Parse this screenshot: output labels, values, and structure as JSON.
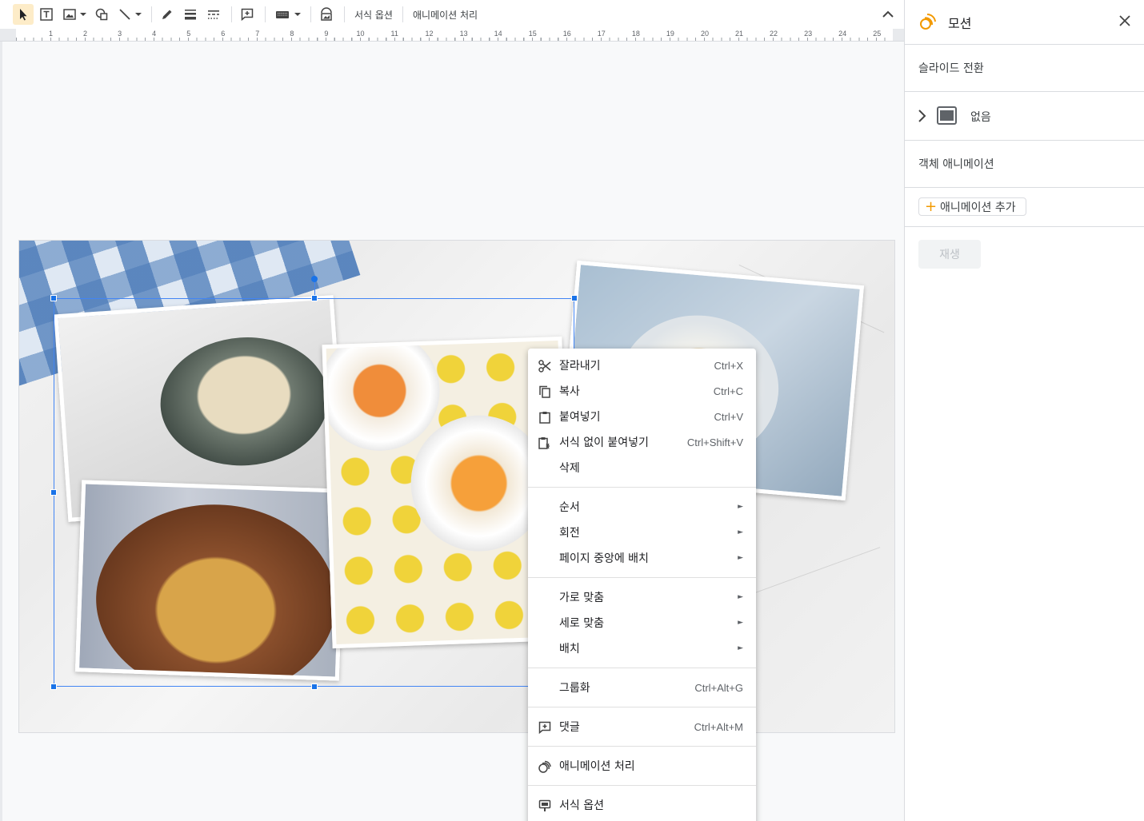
{
  "toolbar": {
    "format_options_label": "서식 옵션",
    "animate_label": "애니메이션 처리"
  },
  "ruler": {
    "numbers": [
      "1",
      "2",
      "3",
      "4",
      "5",
      "6",
      "7",
      "8",
      "9",
      "10",
      "11",
      "12",
      "13",
      "14",
      "15",
      "16",
      "17",
      "18",
      "19",
      "20",
      "21",
      "22",
      "23",
      "24",
      "25"
    ]
  },
  "context_menu": {
    "cut": {
      "label": "잘라내기",
      "shortcut": "Ctrl+X"
    },
    "copy": {
      "label": "복사",
      "shortcut": "Ctrl+C"
    },
    "paste": {
      "label": "붙여넣기",
      "shortcut": "Ctrl+V"
    },
    "paste_plain": {
      "label": "서식 없이 붙여넣기",
      "shortcut": "Ctrl+Shift+V"
    },
    "delete": {
      "label": "삭제"
    },
    "order": {
      "label": "순서"
    },
    "rotate": {
      "label": "회전"
    },
    "center": {
      "label": "페이지 중앙에 배치"
    },
    "align_h": {
      "label": "가로 맞춤"
    },
    "align_v": {
      "label": "세로 맞춤"
    },
    "distribute": {
      "label": "배치"
    },
    "group": {
      "label": "그룹화",
      "shortcut": "Ctrl+Alt+G"
    },
    "comment": {
      "label": "댓글",
      "shortcut": "Ctrl+Alt+M"
    },
    "animate": {
      "label": "애니메이션 처리"
    },
    "format_options": {
      "label": "서식 옵션"
    },
    "submenu_arrow": "►"
  },
  "sidebar": {
    "title": "모션",
    "slide_transition_label": "슬라이드 전환",
    "transition_value": "없음",
    "object_animation_label": "객체 애니메이션",
    "add_animation_label": "애니메이션 추가",
    "play_label": "재생",
    "accent_color": "#f29900"
  }
}
